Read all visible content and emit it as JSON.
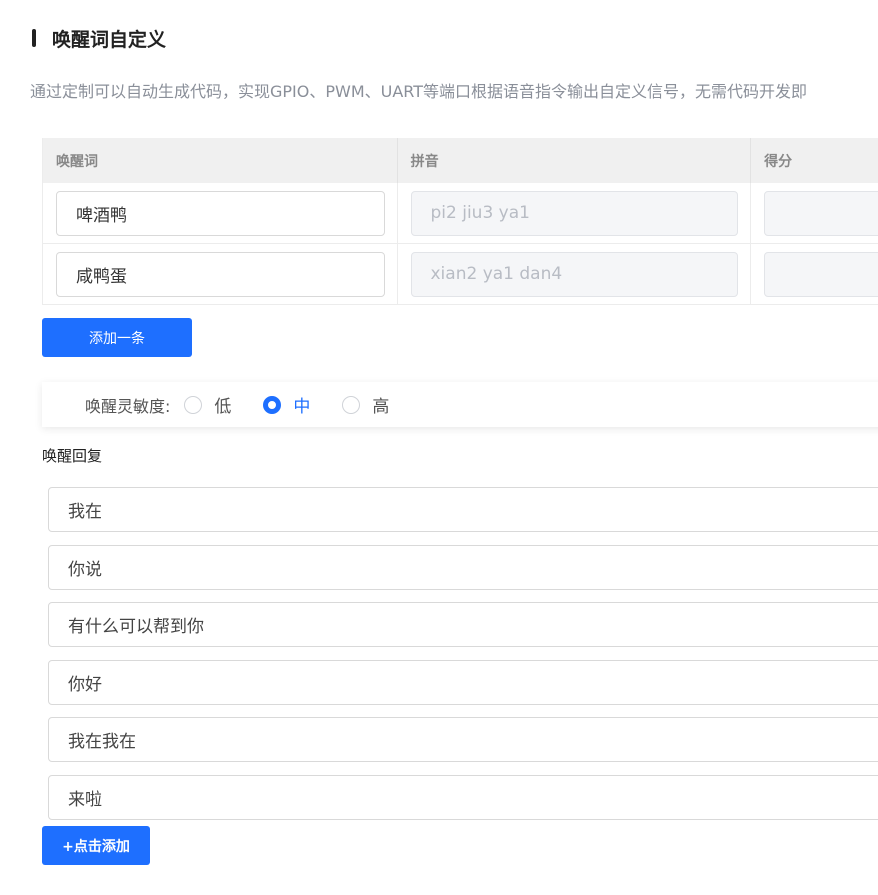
{
  "header": {
    "title": "唤醒词自定义",
    "description": "通过定制可以自动生成代码，实现GPIO、PWM、UART等端口根据语音指令输出自定义信号，无需代码开发即"
  },
  "wake_table": {
    "columns": [
      "唤醒词",
      "拼音",
      "得分"
    ],
    "rows": [
      {
        "word": "啤酒鸭",
        "pinyin": "pi2 jiu3 ya1",
        "score": ""
      },
      {
        "word": "咸鸭蛋",
        "pinyin": "xian2 ya1 dan4",
        "score": ""
      }
    ],
    "add_button_label": "添加一条"
  },
  "sensitivity": {
    "label": "唤醒灵敏度:",
    "options": [
      "低",
      "中",
      "高"
    ],
    "selected": "中"
  },
  "reply": {
    "label": "唤醒回复",
    "items": [
      "我在",
      "你说",
      "有什么可以帮到你",
      "你好",
      "我在我在",
      "来啦"
    ],
    "add_button_label": "+点击添加"
  },
  "colors": {
    "accent": "#1e6fff"
  }
}
